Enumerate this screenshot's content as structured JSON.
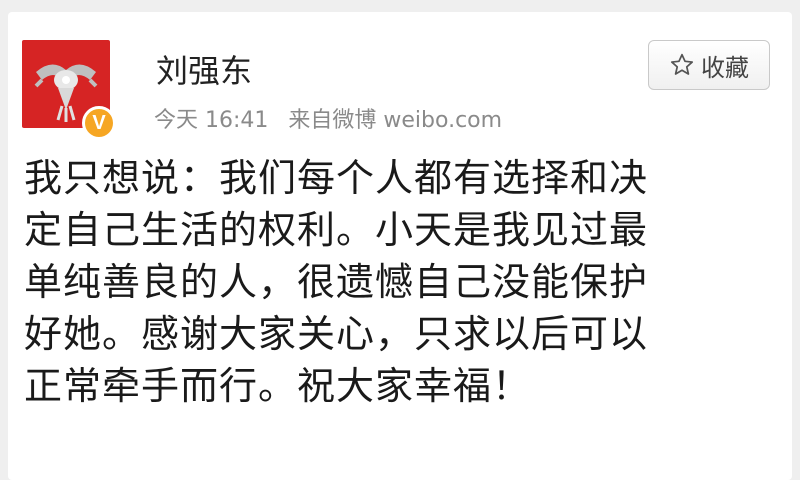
{
  "user": {
    "name": "刘强东",
    "verified_badge": "V"
  },
  "meta": {
    "time": "今天 16:41",
    "source": "来自微博 weibo.com"
  },
  "actions": {
    "favorite_label": "收藏"
  },
  "post": {
    "lines": [
      "我只想说：我们每个人都有选择和决",
      "定自己生活的权利。小天是我见过最",
      "单纯善良的人，很遗憾自己没能保护",
      "好她。感谢大家关心，只求以后可以",
      "正常牵手而行。祝大家幸福！"
    ]
  },
  "colors": {
    "avatar_bg": "#d62424",
    "badge": "#f6a623",
    "meta_text": "#8a8a8a"
  },
  "icons": {
    "avatar": "avatar-figure-icon",
    "favorite": "star-outline-icon"
  }
}
